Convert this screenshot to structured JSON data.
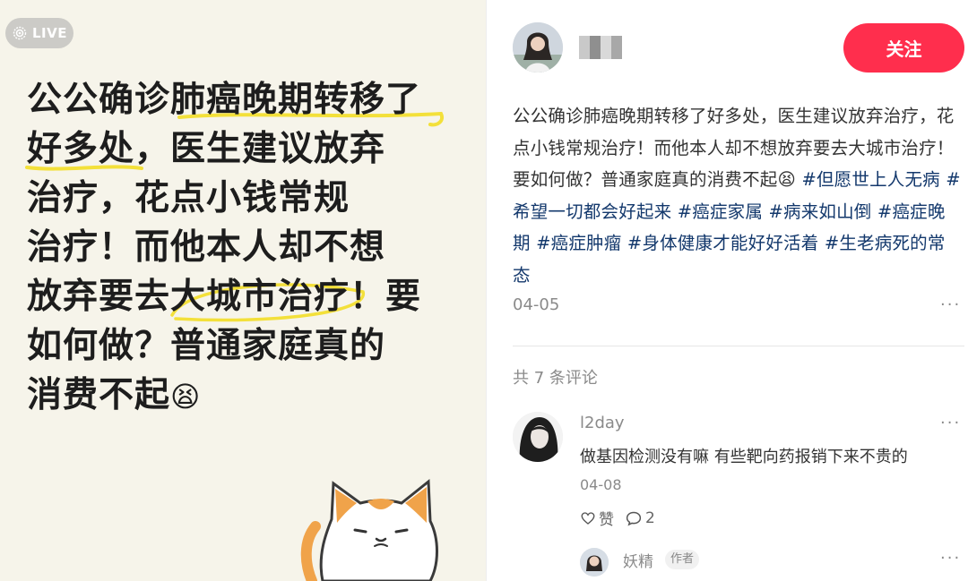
{
  "image_panel": {
    "live_label": "LIVE",
    "headline_lines": [
      [
        "公公确诊",
        "肺癌晚期转移了"
      ],
      [
        "好多处",
        "，医生建议放弃"
      ],
      [
        "治疗，花点小钱常规"
      ],
      [
        "治疗！而他本人却不想"
      ],
      [
        "放弃要去",
        "大城市治疗",
        "！要"
      ],
      [
        "如何做？普通家庭真的"
      ],
      [
        "消费不起",
        "😫"
      ]
    ]
  },
  "author": {
    "avatar_icon": "author-avatar",
    "follow_label": "关注"
  },
  "post": {
    "body_text": "公公确诊肺癌晚期转移了好多处，医生建议放弃治疗，花点小钱常规治疗！而他本人却不想放弃要去大城市治疗！要如何做？普通家庭真的消费不起😫",
    "tags": [
      "#但愿世上人无病",
      "#希望一切都会好起来",
      "#癌症家属",
      "#病来如山倒",
      "#癌症晚期",
      "#癌症肿瘤",
      "#身体健康才能好好活着",
      "#生老病死的常态"
    ],
    "date": "04-05",
    "more": "···"
  },
  "comments": {
    "count_label": "共 7 条评论",
    "items": [
      {
        "user": "l2day",
        "text": "做基因检测没有嘛 有些靶向药报销下来不贵的",
        "date": "04-08",
        "like_label": "赞",
        "reply_count": "2",
        "more": "···"
      }
    ],
    "reply": {
      "user": "妖精",
      "badge": "作者",
      "more": "···"
    }
  },
  "colors": {
    "accent": "#ff2e4d",
    "tag": "#13386c",
    "highlight": "#f3e03a"
  }
}
